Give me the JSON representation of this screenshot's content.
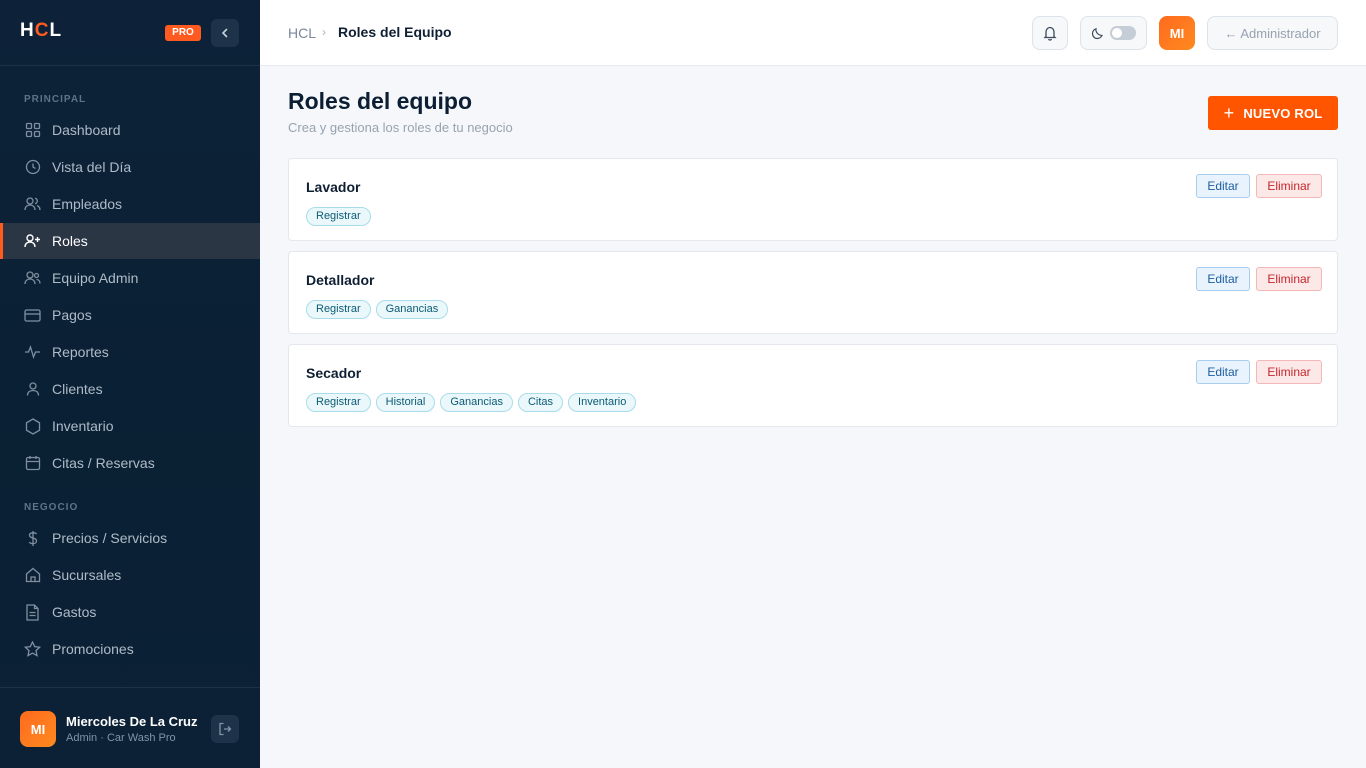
{
  "brand": {
    "logo_prefix": "H",
    "logo_mid": "C",
    "logo_suffix": "L",
    "badge": "PRO",
    "accent": "#ff5a1f"
  },
  "sidebar": {
    "sections": [
      {
        "title": "PRINCIPAL"
      },
      {
        "title": "NEGOCIO"
      }
    ],
    "items": [
      {
        "label": "Dashboard",
        "icon": "grid-icon"
      },
      {
        "label": "Vista del Día",
        "icon": "clock-icon"
      },
      {
        "label": "Empleados",
        "icon": "users-icon"
      },
      {
        "label": "Roles",
        "icon": "user-plus-icon",
        "active": true
      },
      {
        "label": "Equipo Admin",
        "icon": "user-group-icon"
      },
      {
        "label": "Pagos",
        "icon": "credit-card-icon"
      },
      {
        "label": "Reportes",
        "icon": "activity-icon"
      },
      {
        "label": "Clientes",
        "icon": "user-icon"
      },
      {
        "label": "Inventario",
        "icon": "hexagon-icon"
      },
      {
        "label": "Citas / Reservas",
        "icon": "calendar-icon"
      },
      {
        "label": "Precios / Servicios",
        "icon": "dollar-icon"
      },
      {
        "label": "Sucursales",
        "icon": "home-icon"
      },
      {
        "label": "Gastos",
        "icon": "document-icon"
      },
      {
        "label": "Promociones",
        "icon": "star-icon"
      }
    ],
    "user": {
      "initials": "MI",
      "name": "Miercoles De La Cruz",
      "role": "Admin · Car Wash Pro"
    }
  },
  "topbar": {
    "breadcrumb_root": "HCL",
    "breadcrumb_sep": "›",
    "breadcrumb_current": "Roles del Equipo",
    "avatar_initials": "MI",
    "admin_label": "← Administrador"
  },
  "main": {
    "title": "Roles del equipo",
    "subtitle": "Crea y gestiona los roles de tu negocio",
    "new_button": "NUEVO ROL",
    "edit_label": "Editar",
    "delete_label": "Eliminar",
    "roles": [
      {
        "name": "Lavador",
        "permissions": [
          "Registrar"
        ]
      },
      {
        "name": "Detallador",
        "permissions": [
          "Registrar",
          "Ganancias"
        ]
      },
      {
        "name": "Secador",
        "permissions": [
          "Registrar",
          "Historial",
          "Ganancias",
          "Citas",
          "Inventario"
        ]
      }
    ]
  }
}
